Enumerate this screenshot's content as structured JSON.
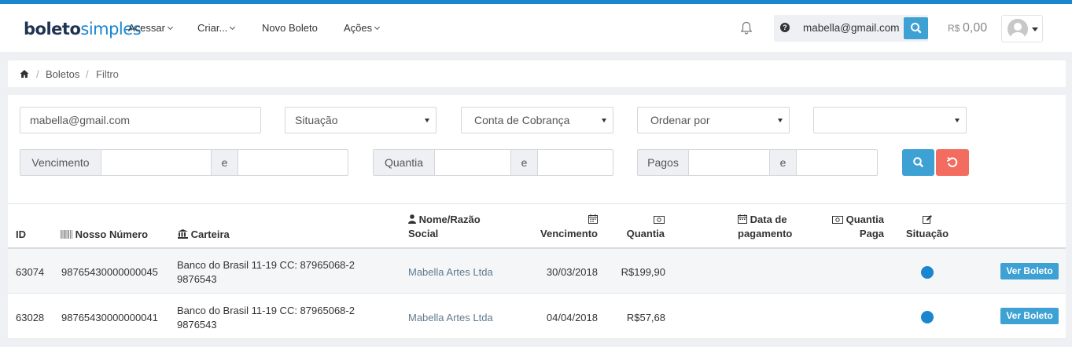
{
  "navbar": {
    "logo_bold": "boleto",
    "logo_light": "simples",
    "menu": [
      {
        "label": "Acessar",
        "dropdown": true
      },
      {
        "label": "Criar...",
        "dropdown": true
      },
      {
        "label": "Novo Boleto",
        "dropdown": false
      },
      {
        "label": "Ações",
        "dropdown": true
      }
    ],
    "search_value": "mabella@gmail.com",
    "balance_currency": "R$",
    "balance_amount": "0,00"
  },
  "breadcrumb": {
    "items": [
      "Boletos",
      "Filtro"
    ]
  },
  "filters": {
    "email_value": "mabella@gmail.com",
    "situacao": "Situação",
    "conta": "Conta de Cobrança",
    "ordenar": "Ordenar por",
    "extra_select": "",
    "vencimento_label": "Vencimento",
    "quantia_label": "Quantia",
    "pagos_label": "Pagos",
    "between_label": "e"
  },
  "table": {
    "headers": {
      "id": "ID",
      "nosso": "Nosso Número",
      "carteira": "Carteira",
      "nome_1": "Nome/Razão",
      "nome_2": "Social",
      "vencimento": "Vencimento",
      "quantia": "Quantia",
      "data_1": "Data de",
      "data_2": "pagamento",
      "qpaga_1": "Quantia",
      "qpaga_2": "Paga",
      "situacao": "Situação"
    },
    "rows": [
      {
        "id": "63074",
        "nosso": "98765430000000045",
        "carteira_1": "Banco do Brasil 11-19 CC: 87965068-2",
        "carteira_2": "9876543",
        "nome": "Mabella Artes Ltda",
        "vencimento": "30/03/2018",
        "quantia": "R$199,90",
        "data_pagamento": "",
        "quantia_paga": "",
        "button": "Ver Boleto"
      },
      {
        "id": "63028",
        "nosso": "98765430000000041",
        "carteira_1": "Banco do Brasil 11-19 CC: 87965068-2",
        "carteira_2": "9876543",
        "nome": "Mabella Artes Ltda",
        "vencimento": "04/04/2018",
        "quantia": "R$57,68",
        "data_pagamento": "",
        "quantia_paga": "",
        "button": "Ver Boleto"
      }
    ]
  },
  "colors": {
    "accent": "#1a86d0",
    "button_blue": "#3ea1d4",
    "button_red": "#f26c5f",
    "status_dot": "#1a86d0"
  }
}
